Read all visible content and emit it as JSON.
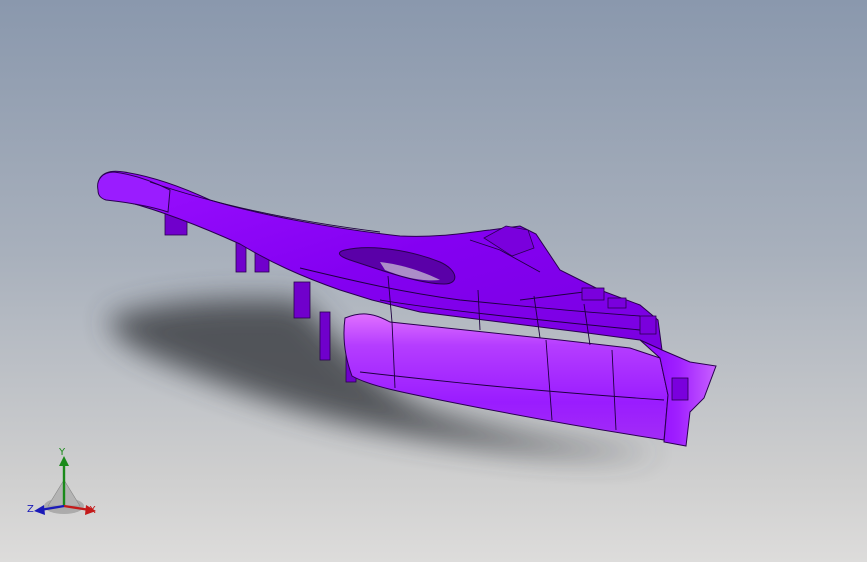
{
  "viewport": {
    "background_top": "#8a98ad",
    "background_bottom": "#dddcdb",
    "part_color": "#8a00ff",
    "part_highlight": "#d24bff",
    "shadow_color": "#4a4d52"
  },
  "triad": {
    "y_label": "Y",
    "z_label": "Z",
    "x_label": "X",
    "y_color": "#1a8a1a",
    "z_color": "#1a1ab8",
    "x_color": "#c41a1a"
  }
}
